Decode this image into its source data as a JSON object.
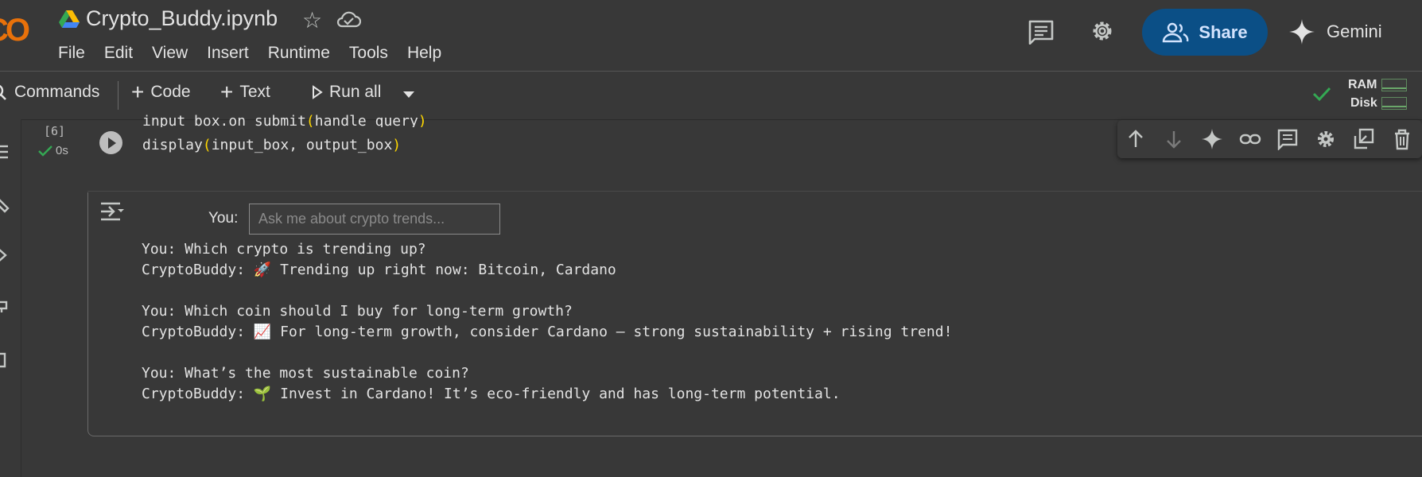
{
  "header": {
    "logo_text": "CO",
    "notebook_title": "Crypto_Buddy.ipynb",
    "menu": [
      "File",
      "Edit",
      "View",
      "Insert",
      "Runtime",
      "Tools",
      "Help"
    ],
    "share_label": "Share",
    "gemini_label": "Gemini"
  },
  "toolbar": {
    "commands_label": "Commands",
    "code_label": "Code",
    "text_label": "Text",
    "run_all_label": "Run all",
    "ram_label": "RAM",
    "disk_label": "Disk"
  },
  "cell": {
    "execution_count": "[6]",
    "exec_time": "0s",
    "code_line1_a": "input_box.on_submit",
    "code_line1_p1": "(",
    "code_line1_b": "handle_query",
    "code_line1_p2": ")",
    "code_line2_a": "display",
    "code_line2_p1": "(",
    "code_line2_b": "input_box, output_box",
    "code_line2_p2": ")"
  },
  "output": {
    "you_label": "You:",
    "input_placeholder": "Ask me about crypto trends...",
    "lines": [
      "You: Which crypto is trending up?",
      "CryptoBuddy: 🚀 Trending up right now: Bitcoin, Cardano",
      "You: Which coin should I buy for long-term growth?",
      "CryptoBuddy: 📈 For long-term growth, consider Cardano — strong sustainability + rising trend!",
      "You: What’s the most sustainable coin?",
      "CryptoBuddy: 🌱 Invest in Cardano! It’s eco-friendly and has long-term potential."
    ]
  },
  "colors": {
    "background": "#383838",
    "share_button": "#0b4f86",
    "success_check": "#34a853",
    "code_paren": "#ffd700"
  }
}
